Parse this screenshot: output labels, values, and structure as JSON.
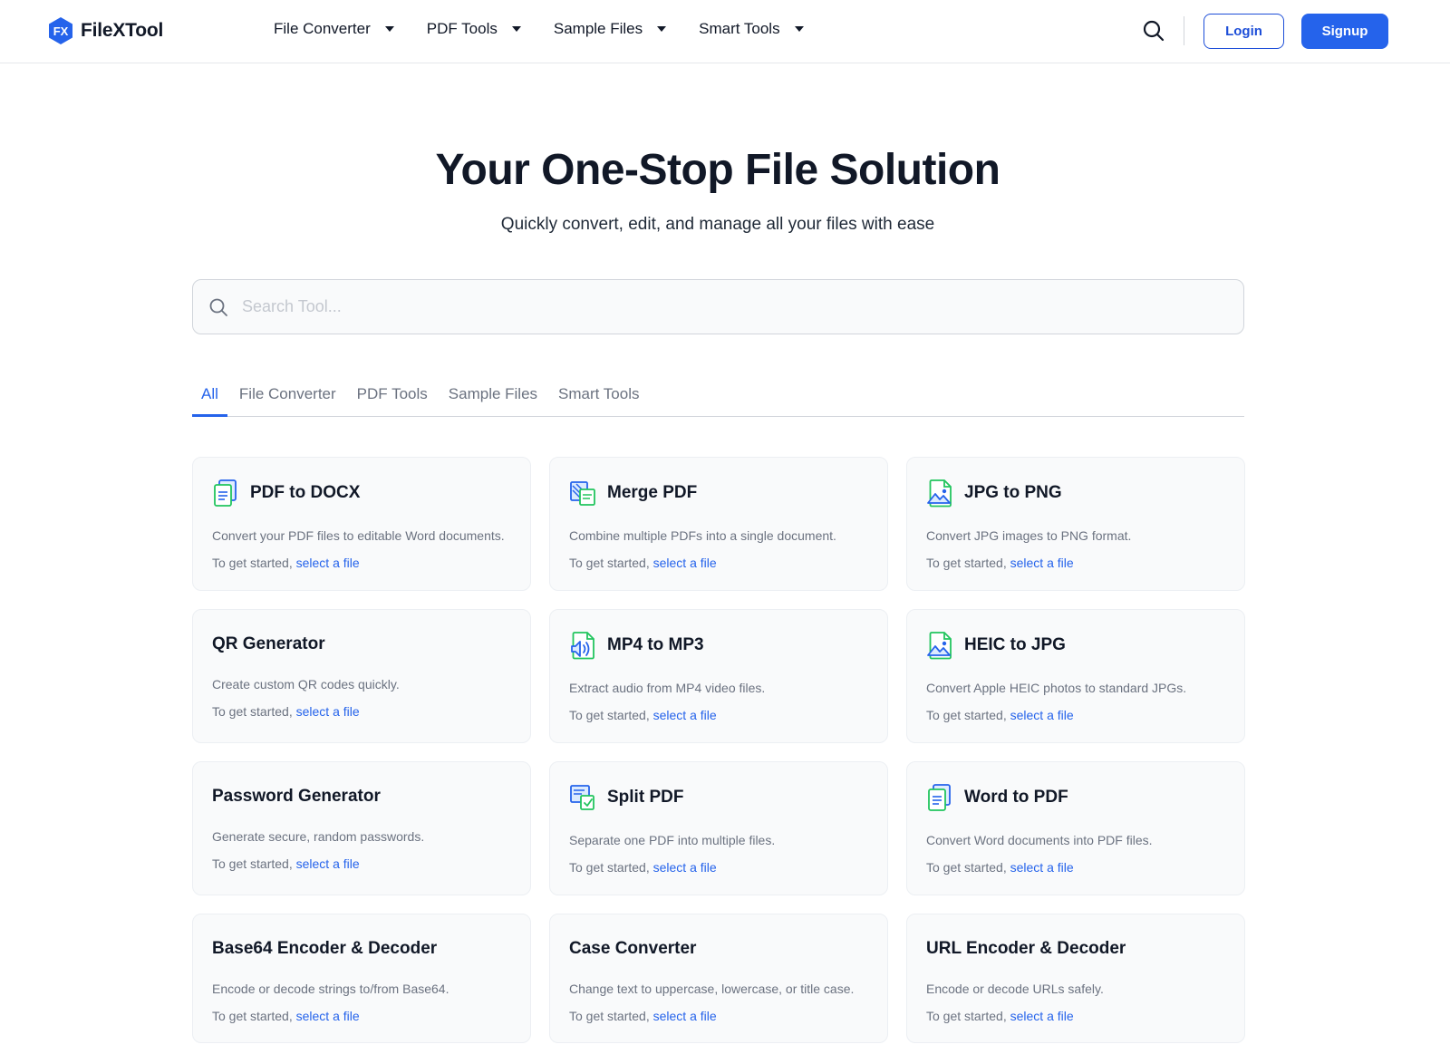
{
  "header": {
    "logo_mark": "FX",
    "logo_text": "FileXTool",
    "nav": [
      "File Converter",
      "PDF Tools",
      "Sample Files",
      "Smart Tools"
    ],
    "login_label": "Login",
    "signup_label": "Signup"
  },
  "hero": {
    "title": "Your One-Stop File Solution",
    "subtitle": "Quickly convert, edit, and manage all your files with ease"
  },
  "search": {
    "placeholder": "Search Tool..."
  },
  "tabs": [
    "All",
    "File Converter",
    "PDF Tools",
    "Sample Files",
    "Smart Tools"
  ],
  "active_tab": "All",
  "cta": {
    "prefix": "To get started,",
    "link": "select a file"
  },
  "cards": [
    {
      "title": "PDF to DOCX",
      "desc": "Convert your PDF files to editable Word documents.",
      "icon": "document-icon"
    },
    {
      "title": "Merge PDF",
      "desc": "Combine multiple PDFs into a single document.",
      "icon": "merge-pdf-icon"
    },
    {
      "title": "JPG to PNG",
      "desc": "Convert JPG images to PNG format.",
      "icon": "image-file-icon"
    },
    {
      "title": "QR Generator",
      "desc": "Create custom QR codes quickly.",
      "icon": ""
    },
    {
      "title": "MP4 to MP3",
      "desc": "Extract audio from MP4 video files.",
      "icon": "audio-file-icon"
    },
    {
      "title": "HEIC to JPG",
      "desc": "Convert Apple HEIC photos to standard JPGs.",
      "icon": "image-file-icon"
    },
    {
      "title": "Password Generator",
      "desc": "Generate secure, random passwords.",
      "icon": ""
    },
    {
      "title": "Split PDF",
      "desc": "Separate one PDF into multiple files.",
      "icon": "split-pdf-icon"
    },
    {
      "title": "Word to PDF",
      "desc": "Convert Word documents into PDF files.",
      "icon": "document-icon"
    },
    {
      "title": "Base64 Encoder & Decoder",
      "desc": "Encode or decode strings to/from Base64.",
      "icon": ""
    },
    {
      "title": "Case Converter",
      "desc": "Change text to uppercase, lowercase, or title case.",
      "icon": ""
    },
    {
      "title": "URL Encoder & Decoder",
      "desc": "Encode or decode URLs safely.",
      "icon": ""
    }
  ],
  "colors": {
    "accent": "#2563eb",
    "icon_green": "#22c55e"
  }
}
